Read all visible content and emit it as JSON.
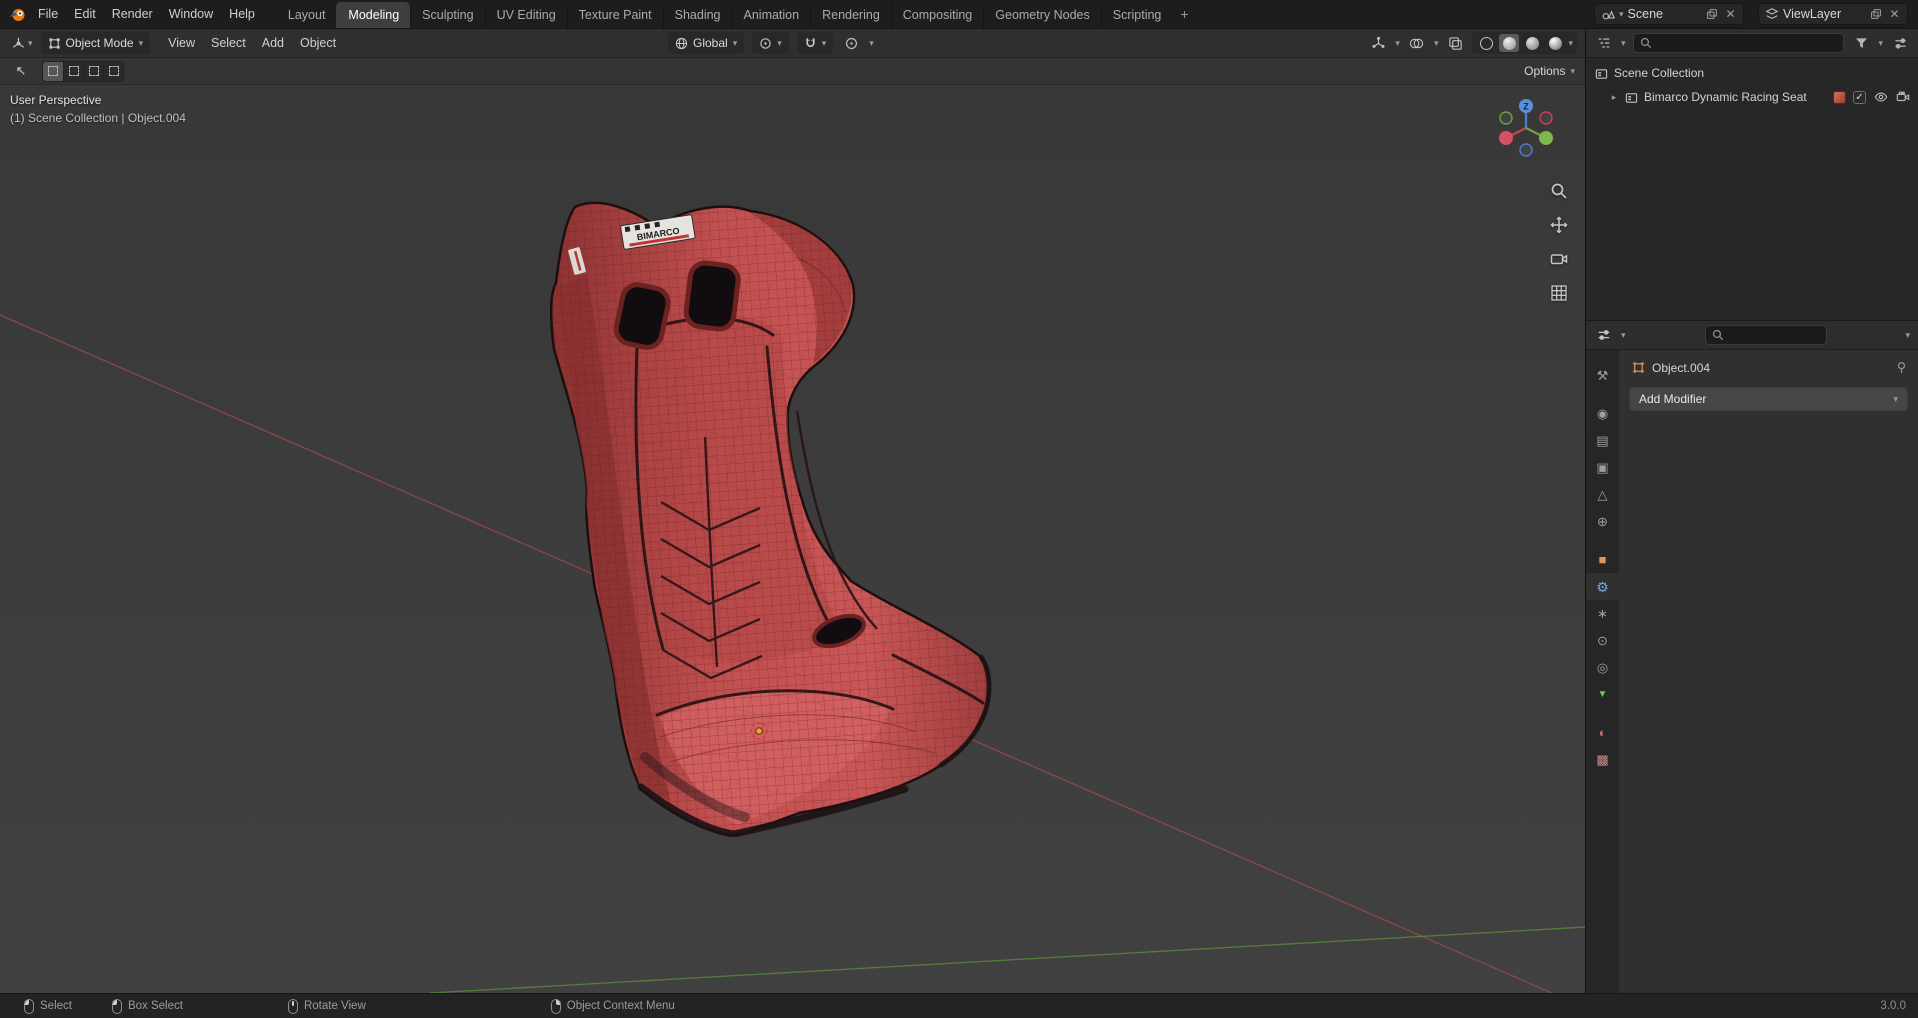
{
  "topbar": {
    "menus": [
      "File",
      "Edit",
      "Render",
      "Window",
      "Help"
    ],
    "workspaces": [
      {
        "label": "Layout"
      },
      {
        "label": "Modeling",
        "active": true
      },
      {
        "label": "Sculpting"
      },
      {
        "label": "UV Editing"
      },
      {
        "label": "Texture Paint"
      },
      {
        "label": "Shading"
      },
      {
        "label": "Animation"
      },
      {
        "label": "Rendering"
      },
      {
        "label": "Compositing"
      },
      {
        "label": "Geometry Nodes"
      },
      {
        "label": "Scripting"
      }
    ],
    "add_workspace_label": "+",
    "scene": {
      "label": "Scene"
    },
    "view_layer": {
      "label": "ViewLayer"
    }
  },
  "viewport_header": {
    "mode": "Object Mode",
    "menus": [
      "View",
      "Select",
      "Add",
      "Object"
    ],
    "orientation": "Global",
    "options_label": "Options"
  },
  "viewport": {
    "perspective_label": "User Perspective",
    "context_label": "(1) Scene Collection | Object.004",
    "seat_logo": "BIMARCO",
    "gizmo_z": "Z"
  },
  "outliner": {
    "scene_collection_label": "Scene Collection",
    "object_label": "Bimarco Dynamic Racing Seat"
  },
  "properties": {
    "breadcrumb": "Object.004",
    "add_modifier_label": "Add Modifier",
    "tabs": [
      {
        "name": "tool-icon",
        "glyph": "⚒",
        "cls": "tgray"
      },
      {
        "name": "render-icon",
        "glyph": "◉",
        "cls": "tgray gap"
      },
      {
        "name": "output-icon",
        "glyph": "▤",
        "cls": "tgray"
      },
      {
        "name": "view-layer-icon",
        "glyph": "▣",
        "cls": "tgray"
      },
      {
        "name": "scene-icon",
        "glyph": "△",
        "cls": "tgray"
      },
      {
        "name": "world-icon",
        "glyph": "⊕",
        "cls": "tgray"
      },
      {
        "name": "object-icon",
        "glyph": "■",
        "cls": "torange gap"
      },
      {
        "name": "modifiers-icon",
        "glyph": "⚙",
        "cls": "tblue",
        "active": true
      },
      {
        "name": "particles-icon",
        "glyph": "∗",
        "cls": "tgray"
      },
      {
        "name": "physics-icon",
        "glyph": "⊙",
        "cls": "tgray"
      },
      {
        "name": "constraints-icon",
        "glyph": "◎",
        "cls": "tgray"
      },
      {
        "name": "object-data-icon",
        "glyph": "▼",
        "cls": "tgreen"
      },
      {
        "name": "material-icon",
        "glyph": "◐",
        "cls": "tred gap"
      },
      {
        "name": "texture-icon",
        "glyph": "▩",
        "cls": "tpink"
      }
    ]
  },
  "statusbar": {
    "hints": [
      {
        "label": "Select",
        "cls": "m-left",
        "name": "mouse-left-icon"
      },
      {
        "label": "Box Select",
        "cls": "m-left",
        "name": "mouse-left-drag-icon"
      },
      {
        "label": "Rotate View",
        "cls": "m-middle",
        "name": "mouse-middle-icon"
      },
      {
        "label": "Object Context Menu",
        "cls": "m-right",
        "name": "mouse-right-icon"
      }
    ],
    "version": "3.0.0"
  },
  "colors": {
    "accent_blue": "#4772b3",
    "object_orange": "#e09553",
    "axis_x": "#d94f63",
    "axis_y": "#6ba53f",
    "axis_z": "#4f7fd0",
    "seat_red": "#c05050"
  }
}
